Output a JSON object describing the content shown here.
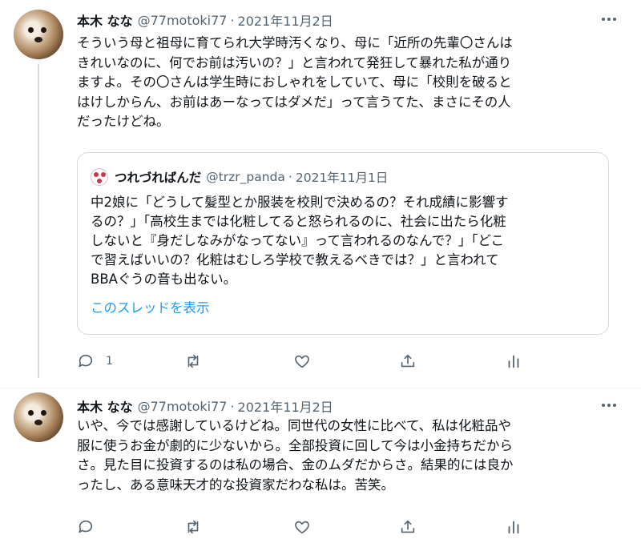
{
  "tweets": [
    {
      "author_name": "本木 なな",
      "handle": "@77motoki77",
      "date": "2021年11月2日",
      "text": "そういう母と祖母に育てられ大学時汚くなり、母に「近所の先輩〇さんは\nきれいなのに、何でお前は汚いの？」と言われて発狂して暴れた私が通り\nますよ。その〇さんは学生時におしゃれをしていて、母に「校則を破ると\nはけしからん、お前はあーなってはダメだ」って言うてた、まさにその人\nだったけどね。",
      "reply_count": "1",
      "quoted": {
        "author_name": "つれづればんだ",
        "handle": "@trzr_panda",
        "date": "2021年11月1日",
        "text": "中2娘に「どうして髪型とか服装を校則で決めるの？それ成績に影響す\nるの？」「高校生までは化粧してると怒られるのに、社会に出たら化粧\nしないと『身だしなみがなってない』って言われるのなんで？」「どこ\nで習えばいいの？化粧はむしろ学校で教えるべきでは？」と言われて\nBBAぐうの音も出ない。",
        "thread_link": "このスレッドを表示"
      }
    },
    {
      "author_name": "本木 なな",
      "handle": "@77motoki77",
      "date": "2021年11月2日",
      "text": "いや、今では感謝しているけどね。同世代の女性に比べて、私は化粧品や\n服に使うお金が劇的に少ないから。全部投資に回して今は小金持ちだから\nさ。見た目に投資するのは私の場合、金のムダだからさ。結果的には良か\nったし、ある意味天才的な投資家だわな私は。苦笑。",
      "reply_count": ""
    }
  ],
  "separator": "·",
  "icons": [
    "more-icon",
    "reply-icon",
    "retweet-icon",
    "like-icon",
    "share-icon",
    "analytics-icon"
  ],
  "colors": {
    "text": "#0f1419",
    "secondary": "#536471",
    "link": "#1d9bf0",
    "border": "#cfd9de"
  }
}
